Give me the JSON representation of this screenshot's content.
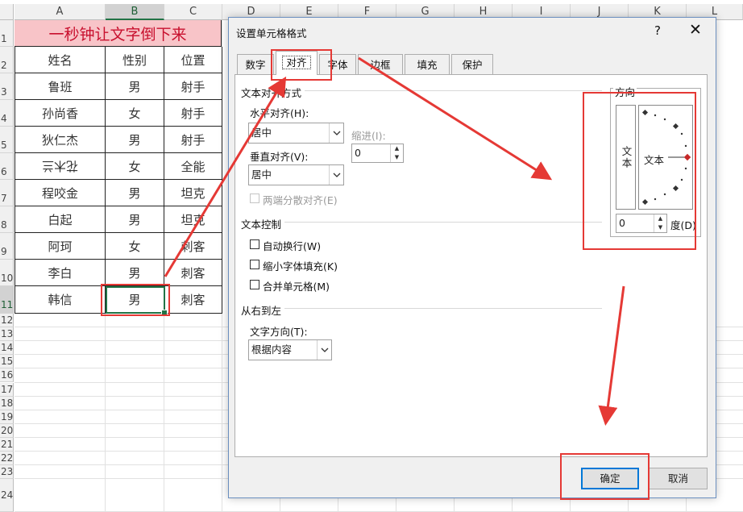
{
  "sheet": {
    "columns": [
      "A",
      "B",
      "C",
      "D",
      "E",
      "F",
      "G",
      "H",
      "I",
      "J",
      "K",
      "L"
    ],
    "rows": [
      "1",
      "2",
      "3",
      "4",
      "5",
      "6",
      "7",
      "8",
      "9",
      "10",
      "11",
      "12",
      "13",
      "14",
      "15",
      "16",
      "17",
      "18",
      "19",
      "20",
      "21",
      "22",
      "23",
      "24"
    ],
    "title": "一秒钟让文字倒下来",
    "headers": [
      "姓名",
      "性别",
      "位置"
    ],
    "data": [
      [
        "鲁班",
        "男",
        "射手"
      ],
      [
        "孙尚香",
        "女",
        "射手"
      ],
      [
        "狄仁杰",
        "男",
        "射手"
      ],
      [
        "花木兰",
        "女",
        "全能"
      ],
      [
        "程咬金",
        "男",
        "坦克"
      ],
      [
        "白起",
        "男",
        "坦克"
      ],
      [
        "阿珂",
        "女",
        "刺客"
      ],
      [
        "李白",
        "男",
        "刺客"
      ],
      [
        "韩信",
        "男",
        "刺客"
      ]
    ]
  },
  "dialog": {
    "title": "设置单元格格式",
    "help": "?",
    "close": "✕",
    "tabs": [
      "数字",
      "对齐",
      "字体",
      "边框",
      "填充",
      "保护"
    ],
    "active_tab": "对齐",
    "text_align_section": "文本对齐方式",
    "horizontal_label": "水平对齐(H):",
    "horizontal_value": "居中",
    "indent_label": "缩进(I):",
    "indent_value": "0",
    "vertical_label": "垂直对齐(V):",
    "vertical_value": "居中",
    "justify_distributed": "两端分散对齐(E)",
    "text_control_section": "文本控制",
    "wrap_text": "自动换行(W)",
    "shrink_to_fit": "缩小字体填充(K)",
    "merge_cells": "合并单元格(M)",
    "rtl_section": "从右到左",
    "direction_label": "文字方向(T):",
    "direction_value": "根据内容",
    "orientation_label": "方向",
    "vertical_text": "文本",
    "dial_text": "文本",
    "degree_value": "0",
    "degree_label": "度(D)",
    "ok": "确定",
    "cancel": "取消"
  },
  "colors": {
    "annotation": "#e53935",
    "title_fill": "#f8c4c8",
    "title_text": "#c8102e",
    "selection": "#217346"
  }
}
